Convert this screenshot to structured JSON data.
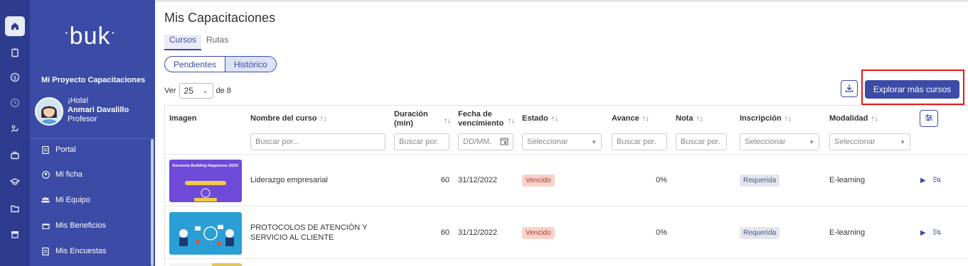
{
  "brand": {
    "logo_text": "buk"
  },
  "colors": {
    "primary": "#3b4ba6",
    "rail": "#2d3c8f",
    "highlight_box": "#e01c1c",
    "venc_bg": "#f8d3ca"
  },
  "rail_icons": [
    "home-icon",
    "clipboard-icon",
    "dollar-icon",
    "clock-icon",
    "health-icon",
    "briefcase-icon",
    "graduation-icon",
    "folder-icon",
    "store-icon"
  ],
  "sidebar": {
    "project": "Mi Proyecto Capacitaciones",
    "greeting": "¡Hola!",
    "user_name": "Anmari Davalillo",
    "user_role": "Profesor",
    "items": [
      {
        "label": "Portal",
        "icon": "document-icon"
      },
      {
        "label": "Mi ficha",
        "icon": "user-circle-icon"
      },
      {
        "label": "Mi Equipo",
        "icon": "team-icon"
      },
      {
        "label": "Mis Beneficios",
        "icon": "gift-icon"
      },
      {
        "label": "Mis Encuestas",
        "icon": "survey-icon"
      }
    ]
  },
  "main": {
    "title": "Mis Capacitaciones",
    "tabs": [
      "Cursos",
      "Rutas"
    ],
    "segments": [
      "Pendientes",
      "Histórico"
    ],
    "ver_label": "Ver",
    "page_size": "25",
    "of_label": "de 8",
    "explore_label": "Explorar más cursos"
  },
  "table": {
    "headers": {
      "imagen": "Imagen",
      "nombre": "Nombre del curso",
      "duracion": "Duración (min)",
      "fecha": "Fecha de vencimiento",
      "estado": "Estado",
      "avance": "Avance",
      "nota": "Nota",
      "inscripcion": "Inscripción",
      "modalidad": "Modalidad"
    },
    "filters": {
      "nombre": "Buscar por...",
      "duracion": "Buscar por.",
      "fecha": "DD/MM.",
      "estado": "Seleccionar",
      "avance": "Buscar por.",
      "nota": "Buscar por.",
      "inscripcion": "Seleccionar",
      "modalidad": "Seleccionar"
    },
    "rows": [
      {
        "nombre": "Liderazgo empresarial",
        "duracion": "60",
        "fecha": "31/12/2022",
        "estado": "Vencido",
        "avance": "0%",
        "inscripcion": "Requerida",
        "modalidad": "E-learning",
        "thumb_text": "Encuesta Building Happiness 2023!"
      },
      {
        "nombre": "PROTOCOLOS DE ATENCIÓN Y SERVICIO AL CLIENTE",
        "duracion": "60",
        "fecha": "31/12/2022",
        "estado": "Vencido",
        "avance": "0%",
        "inscripcion": "Requerida",
        "modalidad": "E-learning",
        "thumb_text": ""
      }
    ]
  }
}
